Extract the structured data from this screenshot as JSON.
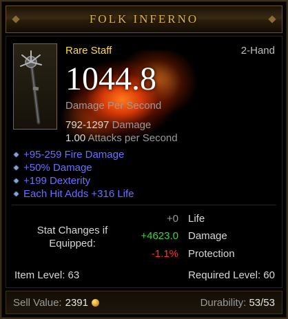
{
  "item": {
    "name": "FOLK INFERNO",
    "type": "Rare Staff",
    "hand": "2-Hand",
    "dps": "1044.8",
    "dps_label": "Damage Per Second",
    "damage_range": "792-1297",
    "damage_label": "Damage",
    "attack_speed": "1.00",
    "attack_speed_label": "Attacks per Second",
    "icon": "staff-icon"
  },
  "affixes": [
    "+95-259 Fire Damage",
    "+50% Damage",
    "+199 Dexterity",
    "Each Hit Adds +316 Life"
  ],
  "stat_changes": {
    "label": "Stat Changes if Equipped:",
    "rows": [
      {
        "value": "+0",
        "name": "Life",
        "tone": "neutral"
      },
      {
        "value": "+4623.0",
        "name": "Damage",
        "tone": "positive"
      },
      {
        "value": "-1.1%",
        "name": "Protection",
        "tone": "negative"
      }
    ]
  },
  "levels": {
    "item_level": "Item Level: 63",
    "required_level": "Required Level: 60"
  },
  "footer": {
    "sell_label": "Sell Value:",
    "sell_value": "2391",
    "durability_label": "Durability:",
    "durability_value": "53/53"
  },
  "colors": {
    "rare": "#ffd94a",
    "magic_affix": "#6d6dff",
    "positive": "#3fd23f",
    "negative": "#ff3030",
    "title": "#d9b44a"
  }
}
